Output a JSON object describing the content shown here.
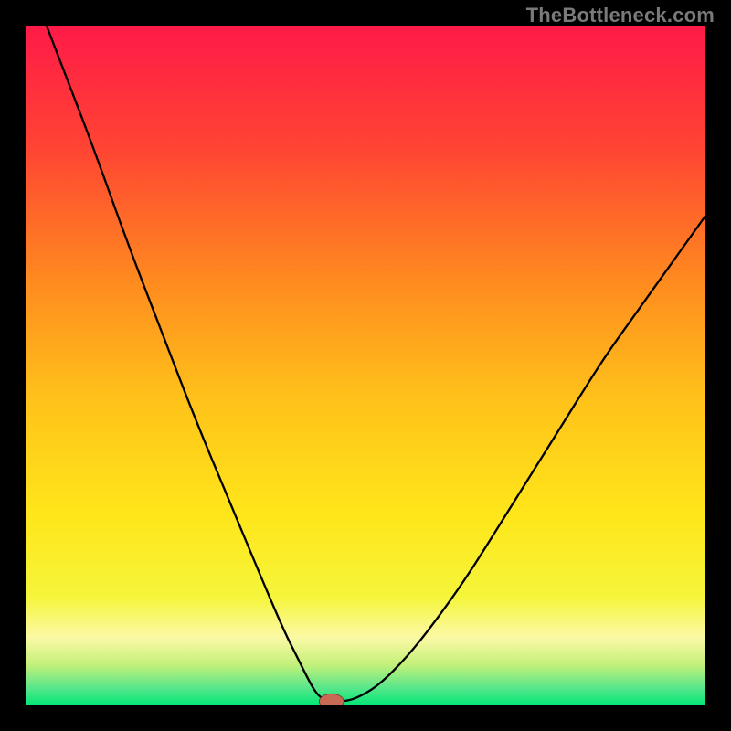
{
  "watermark": "TheBottleneck.com",
  "chart_data": {
    "type": "line",
    "title": "",
    "xlabel": "",
    "ylabel": "",
    "xlim": [
      0,
      100
    ],
    "ylim": [
      0,
      100
    ],
    "grid": false,
    "legend": false,
    "background": {
      "gradient_stops": [
        {
          "offset": 0.0,
          "color": "#ff1a48"
        },
        {
          "offset": 0.18,
          "color": "#ff4433"
        },
        {
          "offset": 0.38,
          "color": "#ff8c1f"
        },
        {
          "offset": 0.55,
          "color": "#ffc21a"
        },
        {
          "offset": 0.72,
          "color": "#ffe61a"
        },
        {
          "offset": 0.84,
          "color": "#f5f53a"
        },
        {
          "offset": 0.9,
          "color": "#fcf9a6"
        },
        {
          "offset": 0.94,
          "color": "#c4f07a"
        },
        {
          "offset": 0.975,
          "color": "#56e68a"
        },
        {
          "offset": 1.0,
          "color": "#00e676"
        }
      ]
    },
    "curve": {
      "name": "bottleneck-curve",
      "color": "#000000",
      "width": 2.3,
      "x": [
        0,
        5,
        10,
        15,
        20,
        25,
        30,
        35,
        38,
        40,
        42,
        43,
        44,
        45,
        47,
        49,
        52,
        56,
        60,
        65,
        70,
        75,
        80,
        85,
        90,
        95,
        100
      ],
      "y": [
        108,
        95,
        82,
        68,
        55,
        42,
        30,
        18,
        11,
        7,
        3,
        1.5,
        0.8,
        0.6,
        0.6,
        1.2,
        3,
        7,
        12,
        19,
        27,
        35,
        43,
        51,
        58,
        65,
        72
      ]
    },
    "marker": {
      "name": "optimal-point",
      "x": 45,
      "y": 0.6,
      "rx": 1.8,
      "ry": 1.1,
      "fill": "#c96a55",
      "stroke": "#7a3a2a"
    }
  }
}
